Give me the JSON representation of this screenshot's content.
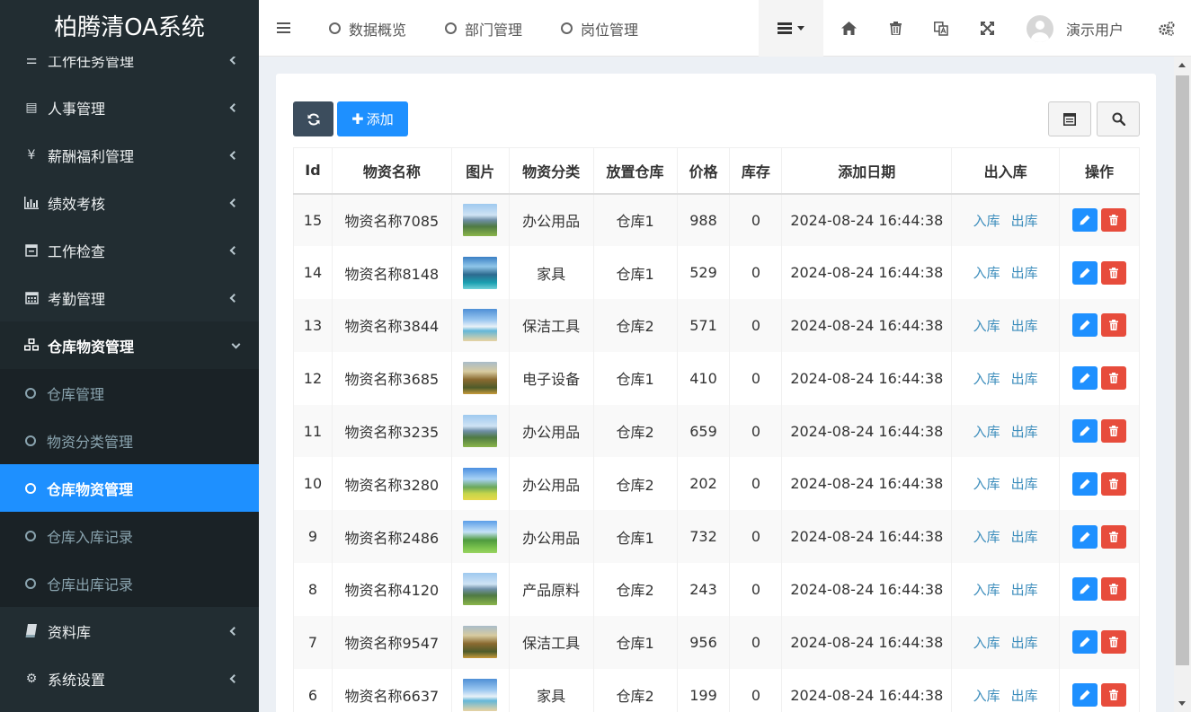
{
  "app": {
    "title": "柏腾清OA系统"
  },
  "sidebar": {
    "items": [
      {
        "label": "工作任务管理",
        "icon": "list-icon"
      },
      {
        "label": "人事管理",
        "icon": "id-card-icon"
      },
      {
        "label": "薪酬福利管理",
        "icon": "yen-icon"
      },
      {
        "label": "绩效考核",
        "icon": "bar-chart-icon"
      },
      {
        "label": "工作检查",
        "icon": "calendar-check-icon"
      },
      {
        "label": "考勤管理",
        "icon": "calendar-icon"
      },
      {
        "label": "仓库物资管理",
        "icon": "cubes-icon"
      }
    ],
    "subitems": [
      {
        "label": "仓库管理"
      },
      {
        "label": "物资分类管理"
      },
      {
        "label": "仓库物资管理"
      },
      {
        "label": "仓库入库记录"
      },
      {
        "label": "仓库出库记录"
      }
    ],
    "after": [
      {
        "label": "资料库",
        "icon": "book-icon"
      },
      {
        "label": "系统设置",
        "icon": "gear-icon"
      }
    ]
  },
  "topbar": {
    "tabs": [
      "数据概览",
      "部门管理",
      "岗位管理"
    ],
    "user": "演示用户"
  },
  "toolbar": {
    "add_label": "添加"
  },
  "table": {
    "headers": [
      "Id",
      "物资名称",
      "图片",
      "物资分类",
      "放置仓库",
      "价格",
      "库存",
      "添加日期",
      "出入库",
      "操作"
    ],
    "in_label": "入库",
    "out_label": "出库",
    "rows": [
      {
        "id": "15",
        "name": "物资名称7085",
        "category": "办公用品",
        "warehouse": "仓库1",
        "price": "988",
        "stock": "0",
        "date": "2024-08-24 16:44:38",
        "img": "mountain"
      },
      {
        "id": "14",
        "name": "物资名称8148",
        "category": "家具",
        "warehouse": "仓库1",
        "price": "529",
        "stock": "0",
        "date": "2024-08-24 16:44:38",
        "img": "lake"
      },
      {
        "id": "13",
        "name": "物资名称3844",
        "category": "保洁工具",
        "warehouse": "仓库2",
        "price": "571",
        "stock": "0",
        "date": "2024-08-24 16:44:38",
        "img": "beach"
      },
      {
        "id": "12",
        "name": "物资名称3685",
        "category": "电子设备",
        "warehouse": "仓库1",
        "price": "410",
        "stock": "0",
        "date": "2024-08-24 16:44:38",
        "img": "autumn"
      },
      {
        "id": "11",
        "name": "物资名称3235",
        "category": "办公用品",
        "warehouse": "仓库2",
        "price": "659",
        "stock": "0",
        "date": "2024-08-24 16:44:38",
        "img": "mountain"
      },
      {
        "id": "10",
        "name": "物资名称3280",
        "category": "办公用品",
        "warehouse": "仓库2",
        "price": "202",
        "stock": "0",
        "date": "2024-08-24 16:44:38",
        "img": "field"
      },
      {
        "id": "9",
        "name": "物资名称2486",
        "category": "办公用品",
        "warehouse": "仓库1",
        "price": "732",
        "stock": "0",
        "date": "2024-08-24 16:44:38",
        "img": "green"
      },
      {
        "id": "8",
        "name": "物资名称4120",
        "category": "产品原料",
        "warehouse": "仓库2",
        "price": "243",
        "stock": "0",
        "date": "2024-08-24 16:44:38",
        "img": "mountain"
      },
      {
        "id": "7",
        "name": "物资名称9547",
        "category": "保洁工具",
        "warehouse": "仓库1",
        "price": "956",
        "stock": "0",
        "date": "2024-08-24 16:44:38",
        "img": "autumn"
      },
      {
        "id": "6",
        "name": "物资名称6637",
        "category": "家具",
        "warehouse": "仓库2",
        "price": "199",
        "stock": "0",
        "date": "2024-08-24 16:44:38",
        "img": "beach"
      }
    ]
  }
}
